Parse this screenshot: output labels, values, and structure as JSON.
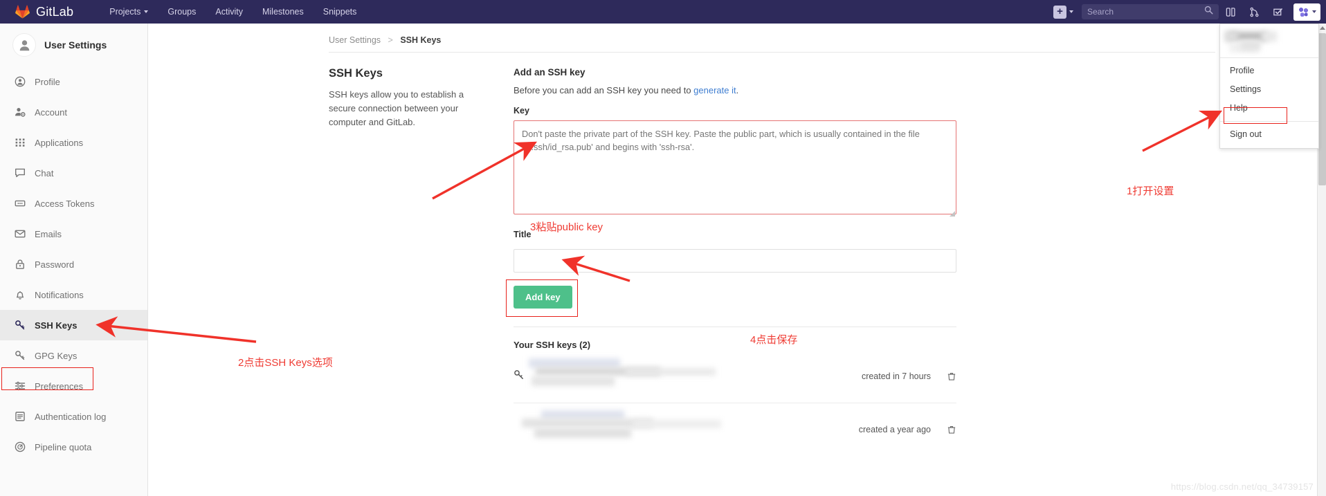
{
  "navbar": {
    "brand": "GitLab",
    "links": [
      {
        "label": "Projects",
        "has_caret": true
      },
      {
        "label": "Groups",
        "has_caret": false
      },
      {
        "label": "Activity",
        "has_caret": false
      },
      {
        "label": "Milestones",
        "has_caret": false
      },
      {
        "label": "Snippets",
        "has_caret": false
      }
    ],
    "plus_label": "+",
    "search_placeholder": "Search",
    "icons": [
      "issue-boards-icon",
      "merge-requests-icon",
      "todos-icon"
    ]
  },
  "user_dropdown": {
    "items": [
      {
        "label": "Profile",
        "highlighted": false
      },
      {
        "label": "Settings",
        "highlighted": true
      },
      {
        "label": "Help",
        "highlighted": false
      }
    ],
    "signout": "Sign out"
  },
  "sidebar": {
    "title": "User Settings",
    "items": [
      {
        "label": "Profile",
        "icon": "user-circle-icon",
        "active": false
      },
      {
        "label": "Account",
        "icon": "user-gear-icon",
        "active": false
      },
      {
        "label": "Applications",
        "icon": "grid-dots-icon",
        "active": false
      },
      {
        "label": "Chat",
        "icon": "chat-bubble-icon",
        "active": false
      },
      {
        "label": "Access Tokens",
        "icon": "token-icon",
        "active": false
      },
      {
        "label": "Emails",
        "icon": "envelope-icon",
        "active": false
      },
      {
        "label": "Password",
        "icon": "lock-icon",
        "active": false
      },
      {
        "label": "Notifications",
        "icon": "bell-icon",
        "active": false
      },
      {
        "label": "SSH Keys",
        "icon": "key-icon",
        "active": true
      },
      {
        "label": "GPG Keys",
        "icon": "key-icon",
        "active": false
      },
      {
        "label": "Preferences",
        "icon": "sliders-icon",
        "active": false
      },
      {
        "label": "Authentication log",
        "icon": "list-document-icon",
        "active": false
      },
      {
        "label": "Pipeline quota",
        "icon": "gauge-icon",
        "active": false
      }
    ]
  },
  "breadcrumb": {
    "parent": "User Settings",
    "separator": ">",
    "current": "SSH Keys"
  },
  "page": {
    "heading": "SSH Keys",
    "description": "SSH keys allow you to establish a secure connection between your computer and GitLab."
  },
  "form": {
    "heading": "Add an SSH key",
    "intro_before": "Before you can add an SSH key you need to ",
    "intro_link": "generate it",
    "intro_after": ".",
    "key_label": "Key",
    "key_value": "",
    "key_placeholder": "Don't paste the private part of the SSH key. Paste the public part, which is usually contained in the file '~/.ssh/id_rsa.pub' and begins with 'ssh-rsa'.",
    "title_label": "Title",
    "title_value": "",
    "title_placeholder": "",
    "submit_label": "Add key"
  },
  "keys_list": {
    "heading": "Your SSH keys (2)",
    "rows": [
      {
        "name": "",
        "created": "created in 7 hours",
        "delete_icon": "trash-icon"
      },
      {
        "name": "",
        "created": "created a year ago",
        "delete_icon": "trash-icon"
      }
    ]
  },
  "annotations": [
    {
      "id": "a1",
      "text": "1打开设置"
    },
    {
      "id": "a2",
      "text": "2点击SSH Keys选项"
    },
    {
      "id": "a3",
      "text": "3粘贴public key"
    },
    {
      "id": "a4",
      "text": "4点击保存"
    }
  ],
  "watermark": "https://blog.csdn.net/qq_34739157",
  "colors": {
    "navbar_bg": "#2e2a5b",
    "accent_green": "#4ec08a",
    "annotation_red": "#ef3b33",
    "link_blue": "#3f7ed1"
  }
}
